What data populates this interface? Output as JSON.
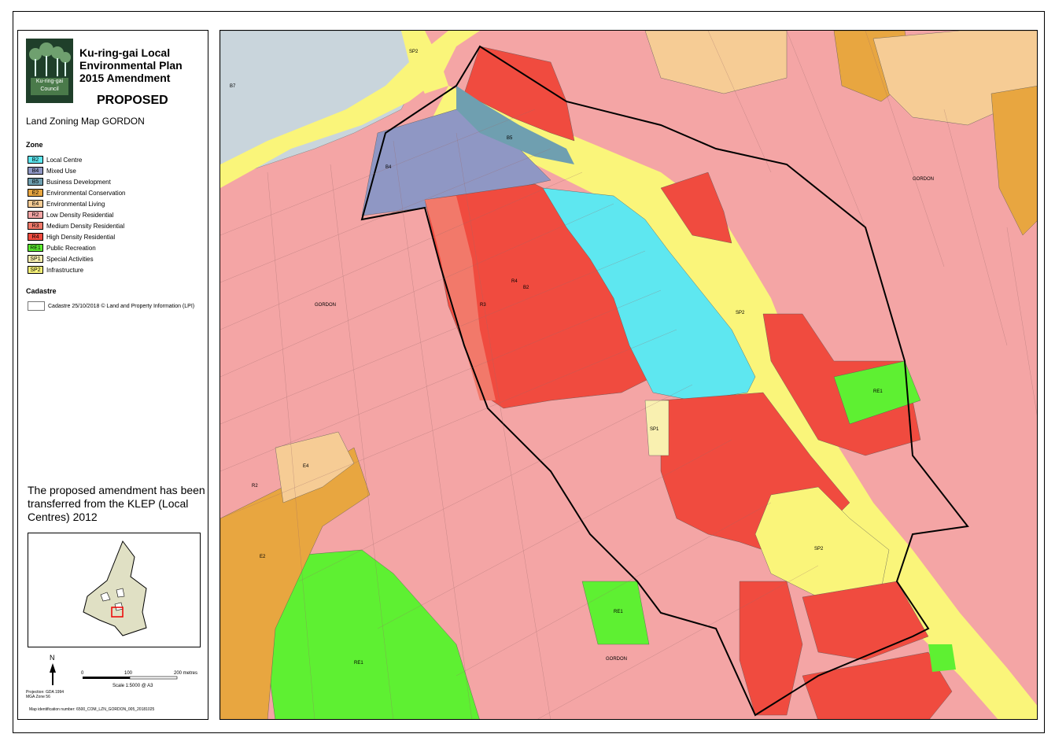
{
  "header": {
    "title": "Ku-ring-gai Local Environmental Plan 2015 Amendment",
    "status": "PROPOSED",
    "subtitle": "Land Zoning Map GORDON",
    "logo_text": "Ku-ring-gai Council"
  },
  "legend": {
    "zone_heading": "Zone",
    "zones": [
      {
        "code": "B2",
        "label": "Local Centre",
        "color": "#5ee7f0"
      },
      {
        "code": "B4",
        "label": "Mixed Use",
        "color": "#8f97c4"
      },
      {
        "code": "B5",
        "label": "Business Development",
        "color": "#6f9fb0"
      },
      {
        "code": "E2",
        "label": "Environmental Conservation",
        "color": "#e8a640"
      },
      {
        "code": "E4",
        "label": "Environmental Living",
        "color": "#f6cc95"
      },
      {
        "code": "R2",
        "label": "Low Density Residential",
        "color": "#f4a5a5"
      },
      {
        "code": "R3",
        "label": "Medium Density Residential",
        "color": "#f2796a"
      },
      {
        "code": "R4",
        "label": "High Density Residential",
        "color": "#f04b3f"
      },
      {
        "code": "RE1",
        "label": "Public Recreation",
        "color": "#5ef032"
      },
      {
        "code": "SP1",
        "label": "Special Activities",
        "color": "#f9f0b0"
      },
      {
        "code": "SP2",
        "label": "Infrastructure",
        "color": "#faf57a"
      }
    ],
    "cadastre_heading": "Cadastre",
    "cadastre_label": "Cadastre 25/10/2018 © Land and Property Information (LPI)"
  },
  "note": "The proposed amendment has been transferred from the KLEP (Local Centres) 2012",
  "scale": {
    "north": "N",
    "ticks": [
      "0",
      "100",
      "200 metres"
    ],
    "text": "Scale 1:5000 @ A3"
  },
  "projection": [
    "Projection: GDA 1994",
    "MGA Zone 56"
  ],
  "map_id": "Map identification number: 6500_COM_LZN_GORDON_005_20181025",
  "map_labels": {
    "gordon": "GORDON",
    "B2": "B2",
    "B4": "B4",
    "B5": "B5",
    "B7": "B7",
    "E2": "E2",
    "E4": "E4",
    "R2": "R2",
    "R3": "R3",
    "R4": "R4",
    "RE1": "RE1",
    "SP1": "SP1",
    "SP2": "SP2"
  }
}
